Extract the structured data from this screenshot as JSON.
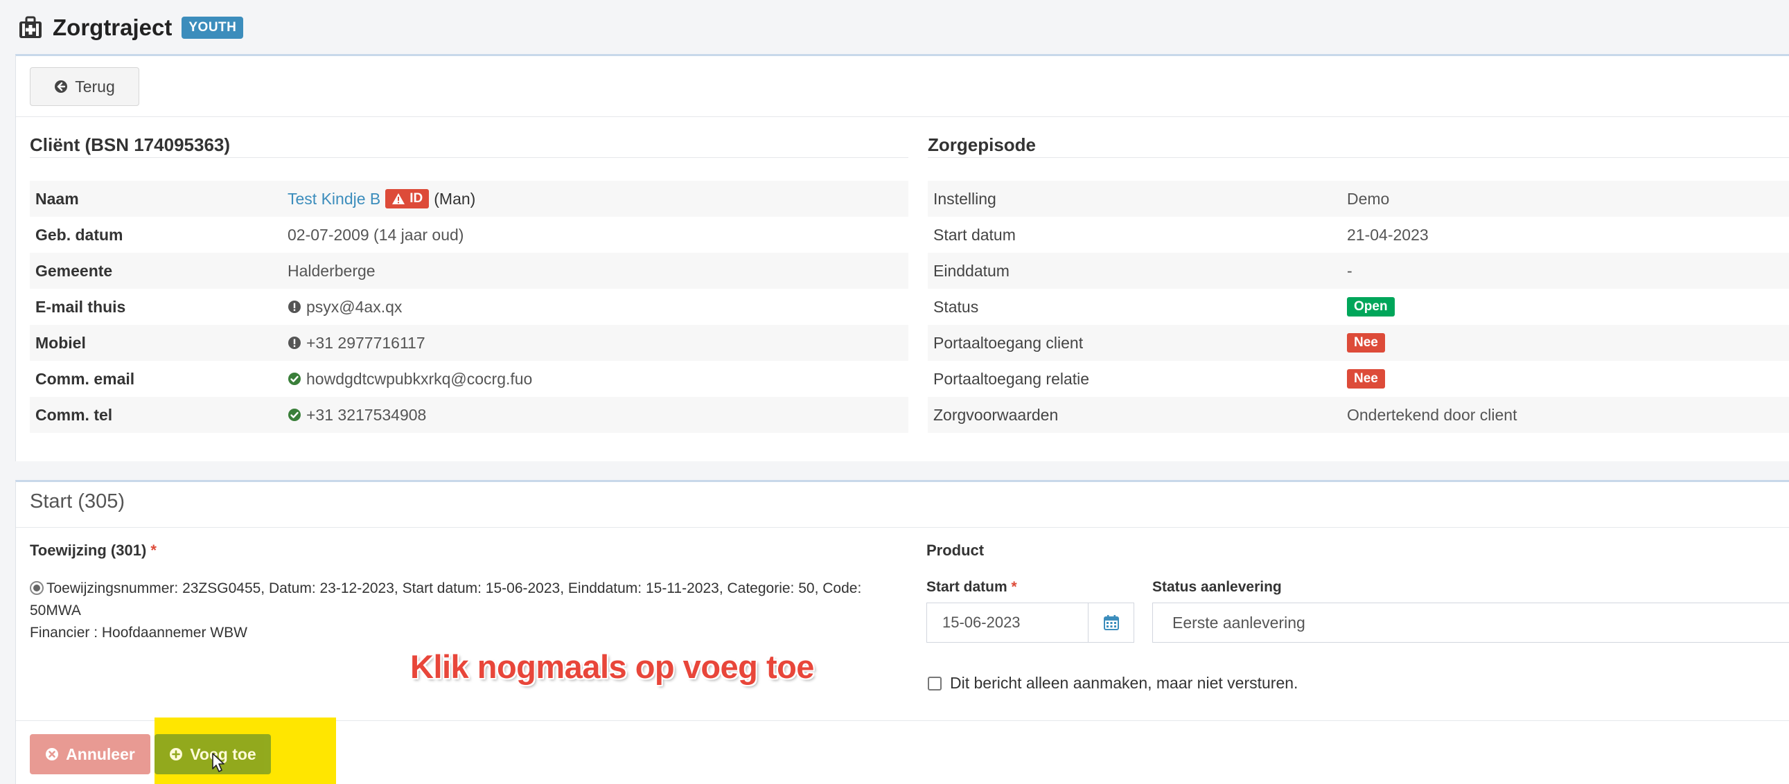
{
  "header": {
    "icon": "medkit-icon",
    "title": "Zorgtraject",
    "badge": "YOUTH"
  },
  "toolbar": {
    "back_label": "Terug",
    "back_icon": "arrow-circle-left-icon"
  },
  "client": {
    "title": "Cliënt (BSN 174095363)",
    "rows": [
      {
        "label": "Naam",
        "value": "Test Kindje B",
        "id_badge": "ID",
        "gender": "(Man)"
      },
      {
        "label": "Geb. datum",
        "value": "02-07-2009 (14 jaar oud)"
      },
      {
        "label": "Gemeente",
        "value": "Halderberge"
      },
      {
        "label": "E-mail thuis",
        "value": "psyx@4ax.qx",
        "icon": "exclamation-circle-icon"
      },
      {
        "label": "Mobiel",
        "value": "+31 2977716117",
        "icon": "exclamation-circle-icon"
      },
      {
        "label": "Comm. email",
        "value": "howdgdtcwpubkxrkq@cocrg.fuo",
        "icon": "check-circle-icon"
      },
      {
        "label": "Comm. tel",
        "value": "+31 3217534908",
        "icon": "check-circle-icon"
      }
    ]
  },
  "episode": {
    "title": "Zorgepisode",
    "rows": [
      {
        "label": "Instelling",
        "value": "Demo"
      },
      {
        "label": "Start datum",
        "value": "21-04-2023"
      },
      {
        "label": "Einddatum",
        "value": "-"
      },
      {
        "label": "Status",
        "value": "Open"
      },
      {
        "label": "Portaaltoegang client",
        "value": "Nee"
      },
      {
        "label": "Portaaltoegang relatie",
        "value": "Nee"
      },
      {
        "label": "Zorgvoorwaarden",
        "value": "Ondertekend door client"
      }
    ]
  },
  "start_form": {
    "title": "Start (305)",
    "assignment_label": "Toewijzing (301)",
    "required_mark": "*",
    "assignment_line1": "Toewijzingsnummer: 23ZSG0455, Datum: 23-12-2023, Start datum: 15-06-2023, Einddatum: 15-11-2023, Categorie: 50, Code:",
    "assignment_line2": "50MWA",
    "financier": "Financier : Hoofdaannemer WBW",
    "product_label": "Product",
    "start_date_label": "Start datum",
    "start_date_value": "15-06-2023",
    "status_label": "Status aanlevering",
    "status_value": "Eerste aanlevering",
    "checkbox_label": "Dit bericht alleen aanmaken, maar niet versturen.",
    "cancel_label": "Annuleer",
    "add_label": "Voeg toe"
  },
  "annotation": {
    "caption": "Klik nogmaals op voeg toe",
    "highlight_color": "#ffe600"
  },
  "colors": {
    "primary": "#3c8dbc",
    "danger": "#dd4b39",
    "success": "#00a65a"
  }
}
